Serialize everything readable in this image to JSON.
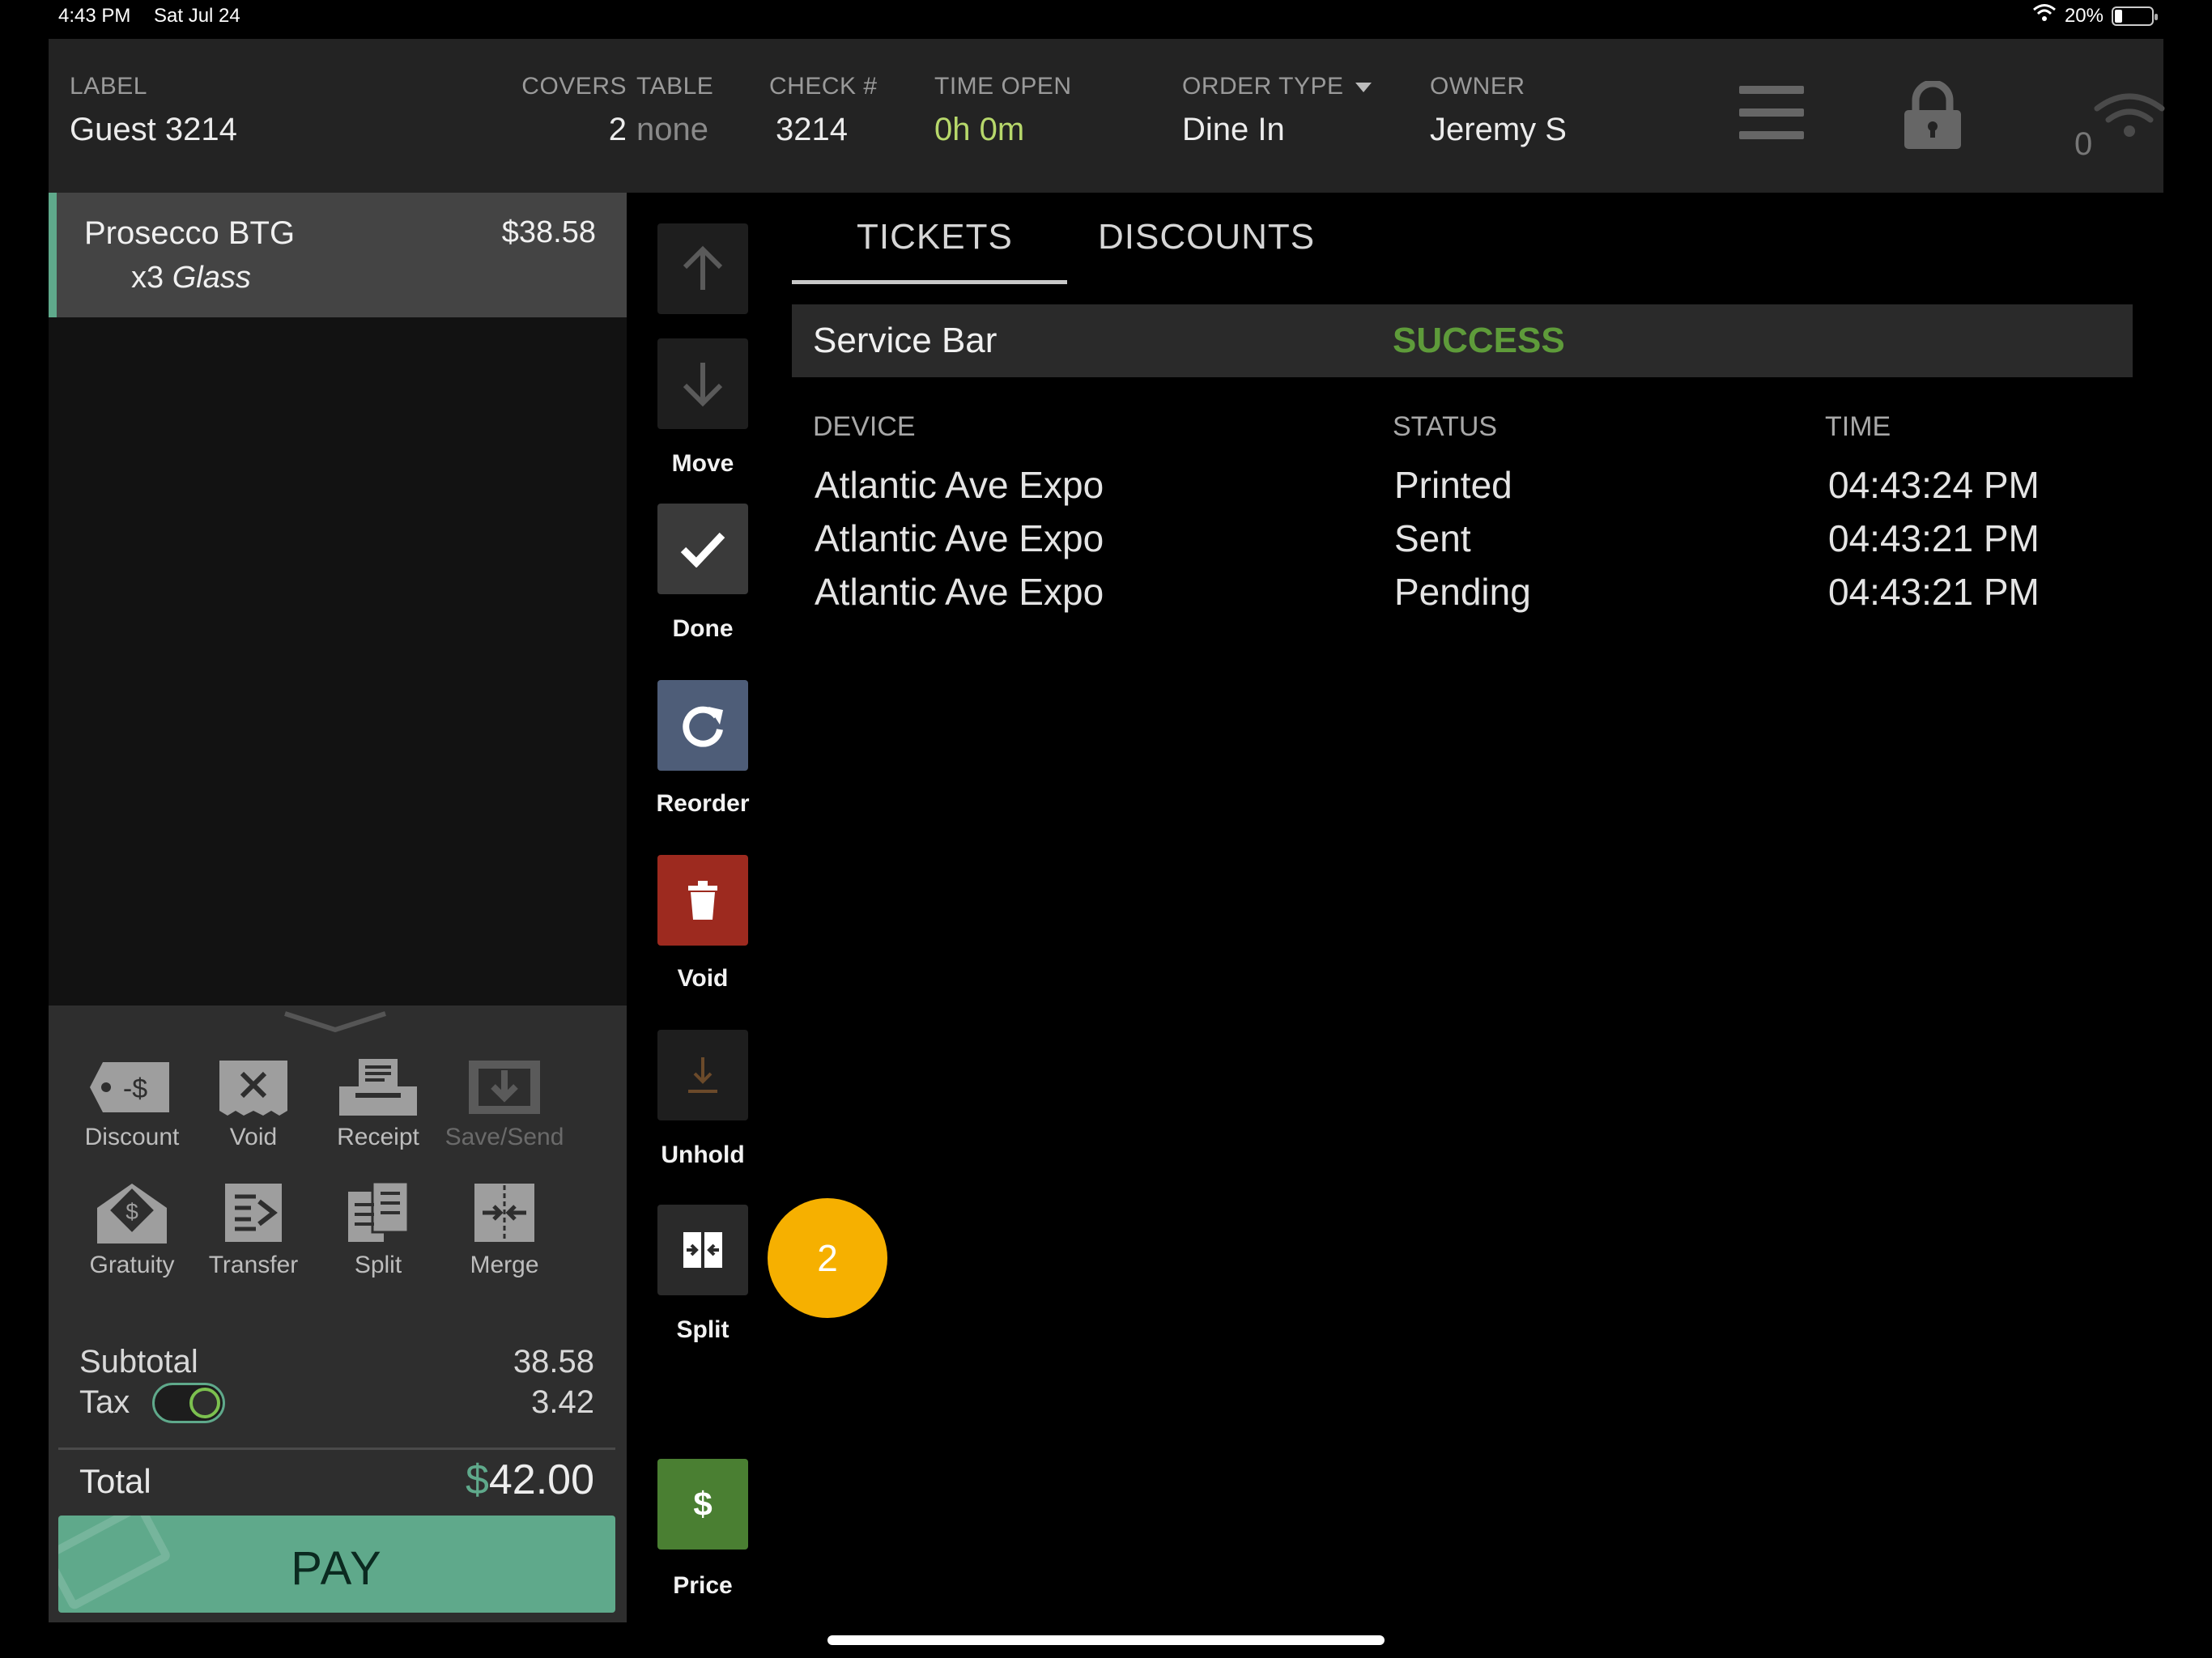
{
  "status_bar": {
    "time": "4:43 PM",
    "date": "Sat Jul 24",
    "battery": "20%",
    "battery_level": 0.2
  },
  "header": {
    "label": {
      "title": "LABEL",
      "value": "Guest 3214"
    },
    "covers": {
      "title": "COVERS",
      "value": "2"
    },
    "table": {
      "title": "TABLE",
      "value": "none"
    },
    "check": {
      "title": "CHECK #",
      "value": "3214"
    },
    "time_open": {
      "title": "TIME OPEN",
      "value": "0h 0m"
    },
    "order_type": {
      "title": "ORDER TYPE",
      "value": "Dine In"
    },
    "owner": {
      "title": "OWNER",
      "value": "Jeremy S"
    },
    "icons": [
      "menu-icon",
      "lock-icon",
      "wifi-icon"
    ],
    "connection_count": "0"
  },
  "order_items": [
    {
      "name": "Prosecco BTG",
      "price": "$38.58",
      "qty": "x3",
      "modifier": "Glass"
    }
  ],
  "check_actions": [
    {
      "label": "Discount",
      "icon": "discount-tag-icon",
      "enabled": true
    },
    {
      "label": "Void",
      "icon": "void-receipt-icon",
      "enabled": true
    },
    {
      "label": "Receipt",
      "icon": "printer-icon",
      "enabled": true
    },
    {
      "label": "Save/Send",
      "icon": "save-send-icon",
      "enabled": false
    },
    {
      "label": "Gratuity",
      "icon": "gratuity-icon",
      "enabled": true
    },
    {
      "label": "Transfer",
      "icon": "transfer-icon",
      "enabled": true
    },
    {
      "label": "Split",
      "icon": "split-check-icon",
      "enabled": true
    },
    {
      "label": "Merge",
      "icon": "merge-icon",
      "enabled": true
    }
  ],
  "totals": {
    "subtotal_label": "Subtotal",
    "subtotal": "38.58",
    "tax_label": "Tax",
    "tax": "3.42",
    "tax_enabled": true,
    "total_label": "Total",
    "currency": "$",
    "total": "42.00"
  },
  "pay_label": "PAY",
  "item_actions": [
    {
      "label": "",
      "icon": "arrow-up-icon",
      "color": "#1e1e1e"
    },
    {
      "label": "Move",
      "icon": "arrow-down-icon",
      "color": "#1e1e1e"
    },
    {
      "label": "Done",
      "icon": "checkmark-icon",
      "color": "#3a3a3a"
    },
    {
      "label": "Reorder",
      "icon": "reorder-icon",
      "color": "#4e5d78"
    },
    {
      "label": "Void",
      "icon": "trash-icon",
      "color": "#9d2a1f"
    },
    {
      "label": "Unhold",
      "icon": "unhold-icon",
      "color": "#1e1e1e"
    },
    {
      "label": "Split",
      "icon": "split-item-icon",
      "color": "#2a2a2a"
    },
    {
      "label": "Price",
      "icon": "dollar-icon",
      "color": "#4a7f32"
    }
  ],
  "step_badge": "2",
  "tabs": [
    {
      "label": "TICKETS",
      "active": true
    },
    {
      "label": "DISCOUNTS",
      "active": false
    }
  ],
  "ticket": {
    "destination": "Service Bar",
    "status": "SUCCESS",
    "columns": [
      "DEVICE",
      "STATUS",
      "TIME"
    ],
    "rows": [
      {
        "device": "Atlantic Ave Expo",
        "status": "Printed",
        "time": "04:43:24 PM"
      },
      {
        "device": "Atlantic Ave Expo",
        "status": "Sent",
        "time": "04:43:21 PM"
      },
      {
        "device": "Atlantic Ave Expo",
        "status": "Pending",
        "time": "04:43:21 PM"
      }
    ]
  },
  "colors": {
    "accent": "#5fa98b",
    "success": "#5e9b3a",
    "badge": "#f6b000",
    "void": "#9d2a1f"
  }
}
